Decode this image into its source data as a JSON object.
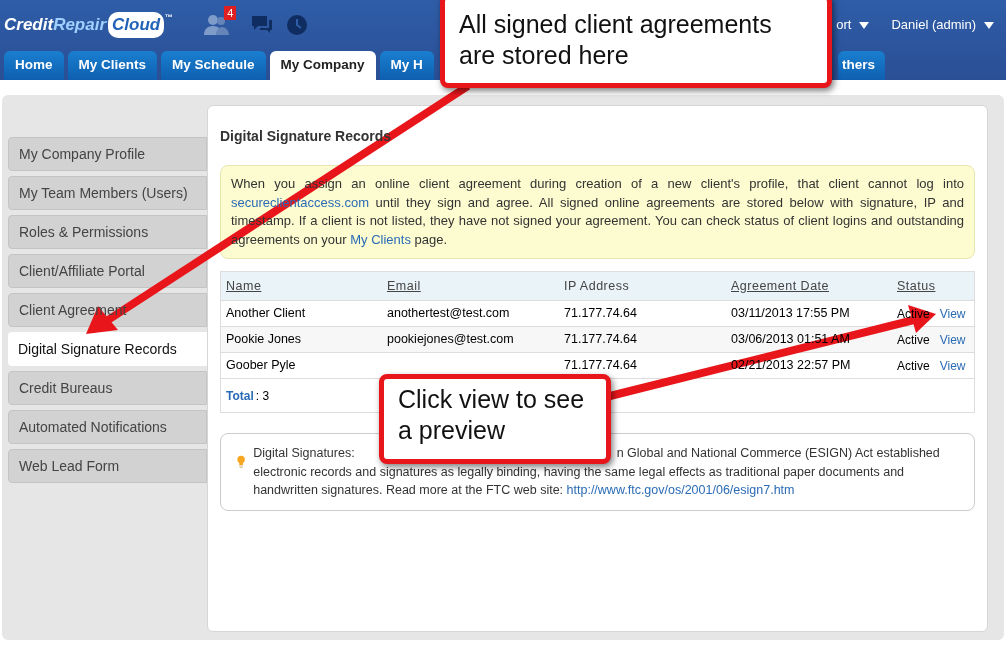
{
  "header": {
    "logo": {
      "first": "Credit",
      "second": "Repair",
      "third": "Cloud",
      "mark": "™"
    },
    "notification_count": "4",
    "user_menu": [
      {
        "label": "ort"
      },
      {
        "label": "Daniel (admin)"
      }
    ]
  },
  "tabs": [
    {
      "label": "Home",
      "selected": false
    },
    {
      "label": "My Clients",
      "selected": false
    },
    {
      "label": "My Schedule",
      "selected": false
    },
    {
      "label": "My Company",
      "selected": true
    },
    {
      "label": "My H",
      "selected": false
    },
    {
      "label": "thers",
      "selected": false
    }
  ],
  "sidebar": {
    "items": [
      {
        "label": "My Company Profile",
        "selected": false
      },
      {
        "label": "My Team Members (Users)",
        "selected": false
      },
      {
        "label": "Roles & Permissions",
        "selected": false
      },
      {
        "label": "Client/Affiliate Portal",
        "selected": false
      },
      {
        "label": "Client Agreement",
        "selected": false
      },
      {
        "label": "Digital Signature Records",
        "selected": true
      },
      {
        "label": "Credit Bureaus",
        "selected": false
      },
      {
        "label": "Automated Notifications",
        "selected": false
      },
      {
        "label": "Web Lead Form",
        "selected": false
      }
    ]
  },
  "panel": {
    "title": "Digital Signature Records",
    "notice": [
      {
        "kind": "text",
        "text": "When you assign an online client agreement during creation of a new client's profile, that client cannot log into "
      },
      {
        "kind": "link",
        "text": "secureclientaccess.com"
      },
      {
        "kind": "text",
        "text": " until they sign and agree. All signed online agreements are stored below with signature, IP and timestamp. If a client is not listed, they have not signed your agreement. You can check status of client logins and outstanding agreements on your "
      },
      {
        "kind": "link",
        "text": "My Clients"
      },
      {
        "kind": "text",
        "text": " page."
      }
    ],
    "table": {
      "columns": [
        {
          "label": "Name",
          "sortable": true
        },
        {
          "label": "Email",
          "sortable": true
        },
        {
          "label": "IP Address",
          "sortable": false
        },
        {
          "label": "Agreement Date",
          "sortable": true
        },
        {
          "label": "Status",
          "sortable": true
        }
      ],
      "rows": [
        {
          "name": "Another Client",
          "email": "anothertest@test.com",
          "ip": "71.177.74.64",
          "date": "03/11/2013 17:55 PM",
          "status": "Active",
          "action": "View"
        },
        {
          "name": "Pookie Jones",
          "email": "pookiejones@test.com",
          "ip": "71.177.74.64",
          "date": "03/06/2013 01:51 AM",
          "status": "Active",
          "action": "View"
        },
        {
          "name": "Goober Pyle",
          "ip": "71.177.74.64",
          "date": "02/21/2013 22:57 PM",
          "status": "Active",
          "action": "View"
        }
      ],
      "total_label": "Total",
      "total_value": ": 3"
    },
    "info": {
      "lead": "Digital Signatures:",
      "rest": [
        {
          "kind": "text",
          "text": "n Global and National Commerce (ESIGN) Act established electronic records and signatures as legally binding, having the same legal effects as traditional paper documents and handwritten signatures. Read more at the FTC web site: "
        },
        {
          "kind": "link",
          "text": "http://www.ftc.gov/os/2001/06/esign7.htm"
        }
      ]
    }
  },
  "callouts": [
    {
      "text": "All signed client agreements are stored here"
    },
    {
      "text": "Click view to see a preview"
    }
  ]
}
